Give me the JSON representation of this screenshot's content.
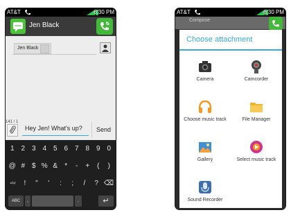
{
  "left_phone": {
    "status": {
      "carrier": "AT&T",
      "network": "4G",
      "time": "6:30 PM"
    },
    "contact_name": "Jen Black",
    "recipient_chip": "Jen Black",
    "char_counter": "141 / 1",
    "message_text": "Hey Jen! What's up?",
    "send_label": "Send",
    "keyboard": {
      "row1": [
        "1",
        "2",
        "3",
        "4",
        "5",
        "6",
        "7",
        "8",
        "9",
        "0"
      ],
      "row2": [
        "@",
        "#",
        "$",
        "%",
        "&",
        "*",
        "-",
        "+",
        "(",
        ")"
      ],
      "row3": [
        "=\\<",
        "!",
        "\"",
        "'",
        ":",
        ";",
        "/",
        "?"
      ],
      "abc_label": "ABC"
    }
  },
  "right_phone": {
    "status": {
      "carrier": "AT&T",
      "network": "4G",
      "time": "6:30 PM"
    },
    "background_title": "Compose",
    "dialog_title": "Choose attachment",
    "items": [
      {
        "label": "Camera"
      },
      {
        "label": "Camcorder"
      },
      {
        "label": "Choose music track"
      },
      {
        "label": "File Manager"
      },
      {
        "label": "Gallery"
      },
      {
        "label": "Select music track"
      },
      {
        "label": "Sound Recorder"
      }
    ]
  },
  "colors": {
    "accent": "#39a8dc",
    "call_green": "#43b83b"
  }
}
